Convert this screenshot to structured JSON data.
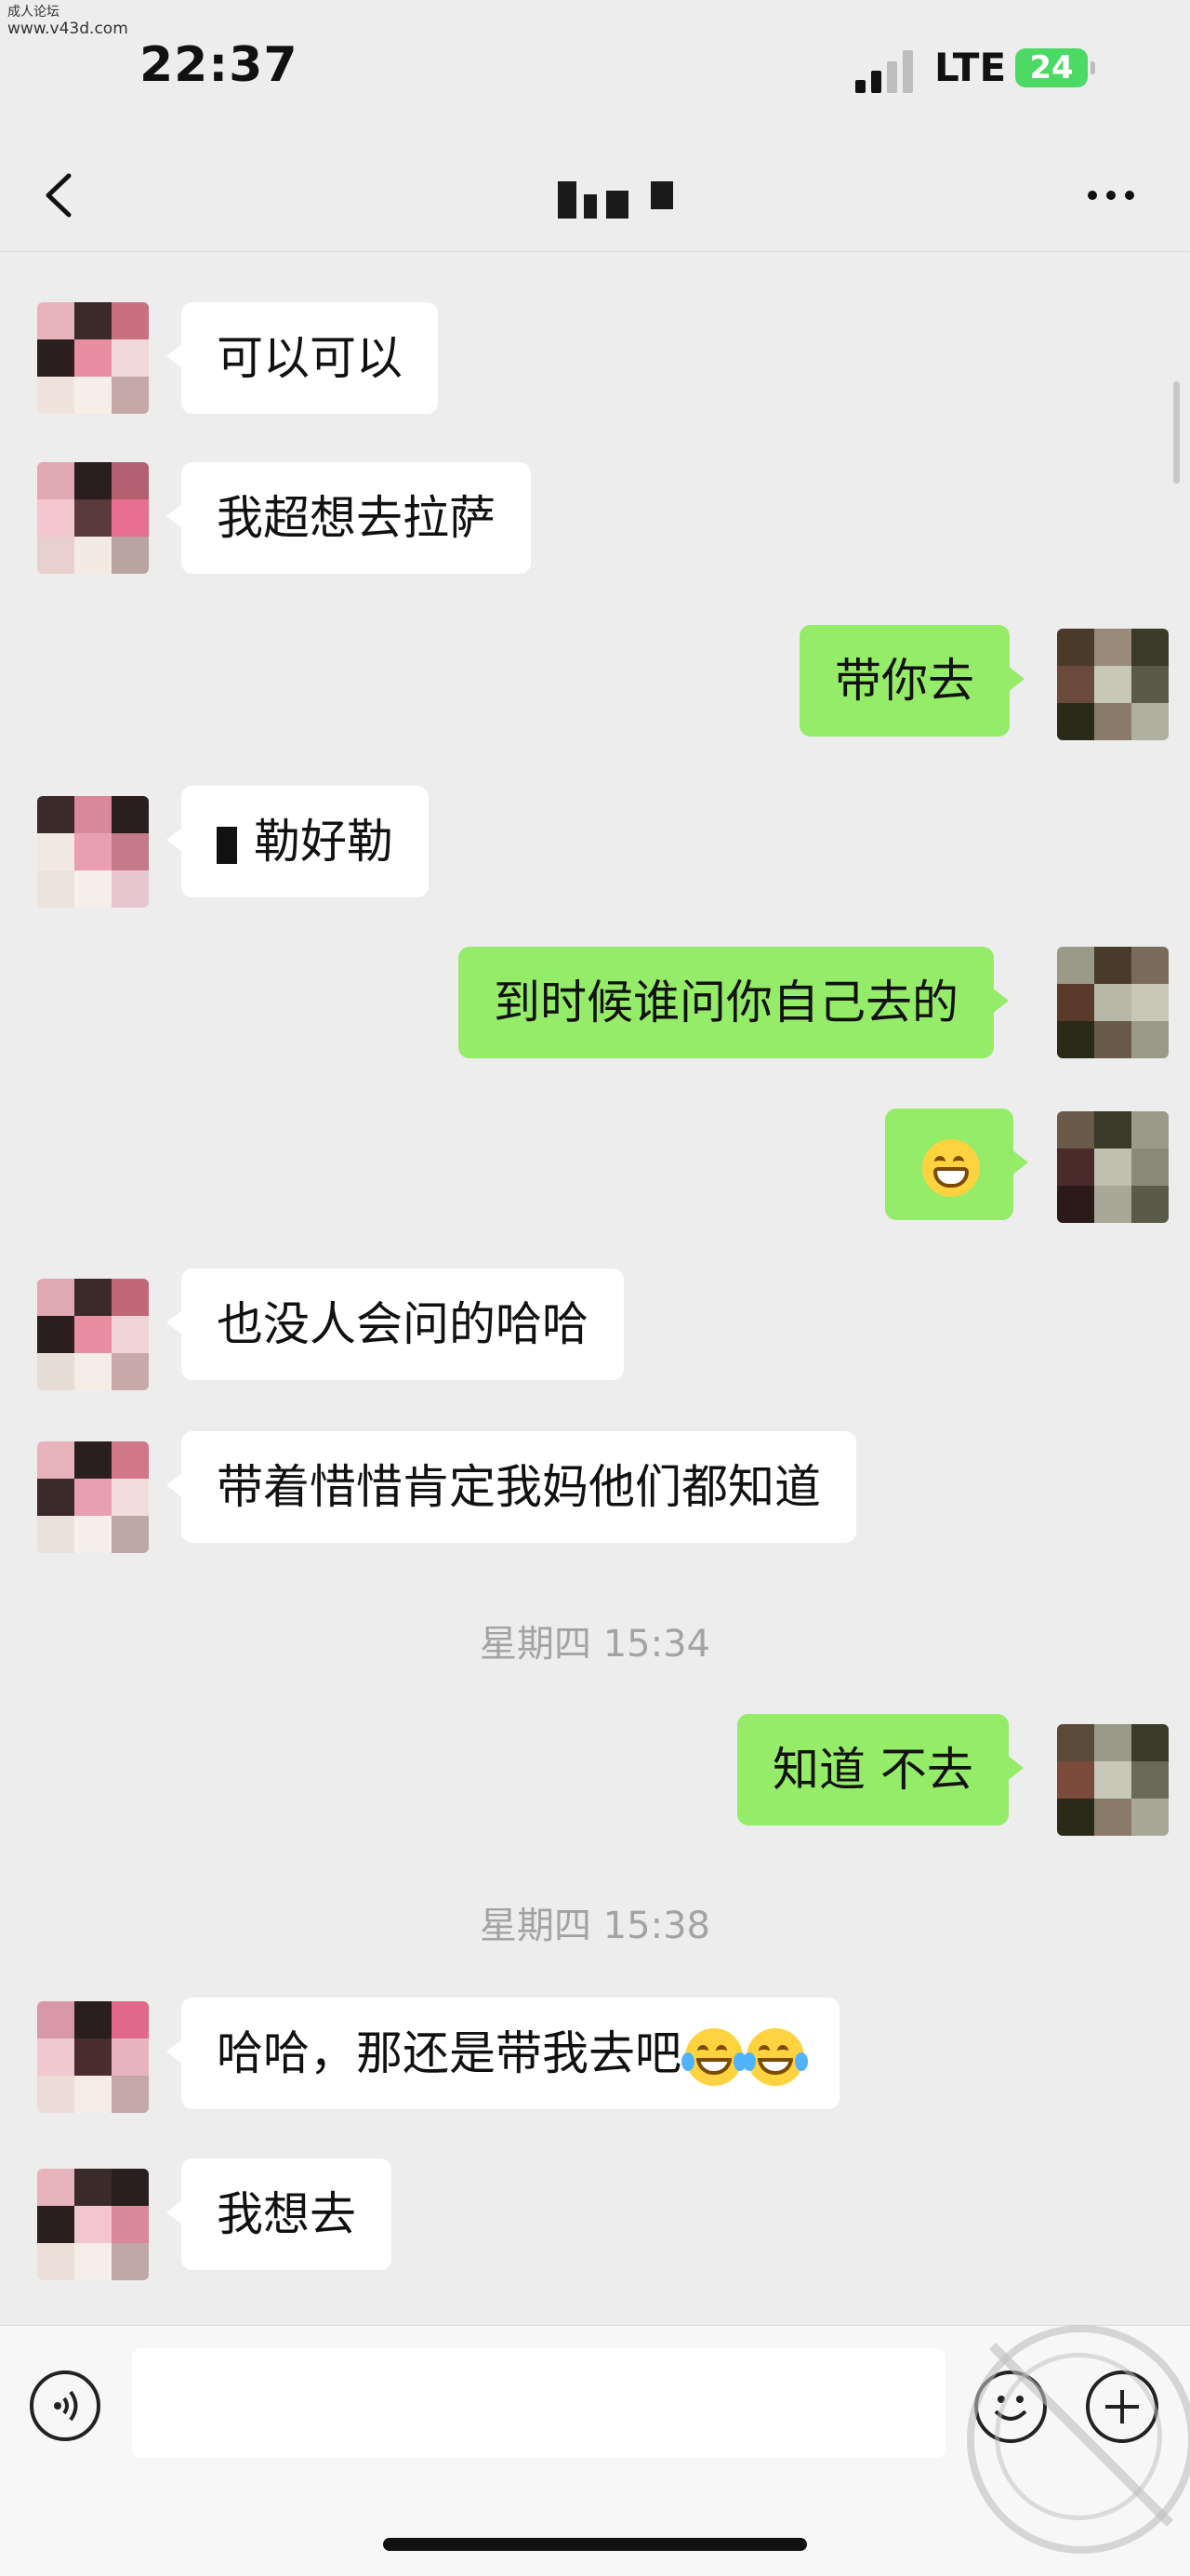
{
  "watermark": {
    "line1": "成人论坛",
    "line2": "www.v43d.com"
  },
  "status": {
    "time": "22:37",
    "network": "LTE",
    "battery": "24"
  },
  "nav": {
    "back_icon": "chevron-left-icon",
    "more_icon": "more-dots-icon"
  },
  "messages": [
    {
      "side": "left",
      "text": "可以可以"
    },
    {
      "side": "left",
      "text": "我超想去拉萨"
    },
    {
      "side": "right",
      "text": "带你去"
    },
    {
      "side": "left",
      "text": "勒好勒",
      "redacted_prefix": true
    },
    {
      "side": "right",
      "text": "到时候谁问你自己去的"
    },
    {
      "side": "right",
      "emoji": "grinning-face-emoji"
    },
    {
      "side": "left",
      "text": "也没人会问的哈哈"
    },
    {
      "side": "left",
      "text": "带着惜惜肯定我妈他们都知道"
    },
    {
      "timestamp": "星期四 15:34"
    },
    {
      "side": "right",
      "text": "知道 不去"
    },
    {
      "timestamp": "星期四 15:38"
    },
    {
      "side": "left",
      "text": "哈哈，那还是带我去吧",
      "emoji": "tears-of-joy-emoji x2"
    },
    {
      "side": "left",
      "text": "我想去"
    }
  ],
  "input_bar": {
    "voice_icon": "voice-icon",
    "emoji_icon": "emoji-icon",
    "plus_icon": "plus-icon",
    "value": ""
  },
  "colors": {
    "background": "#ededed",
    "sent_bubble": "#95ec69",
    "received_bubble": "#ffffff",
    "timestamp": "#a3a3a3"
  }
}
